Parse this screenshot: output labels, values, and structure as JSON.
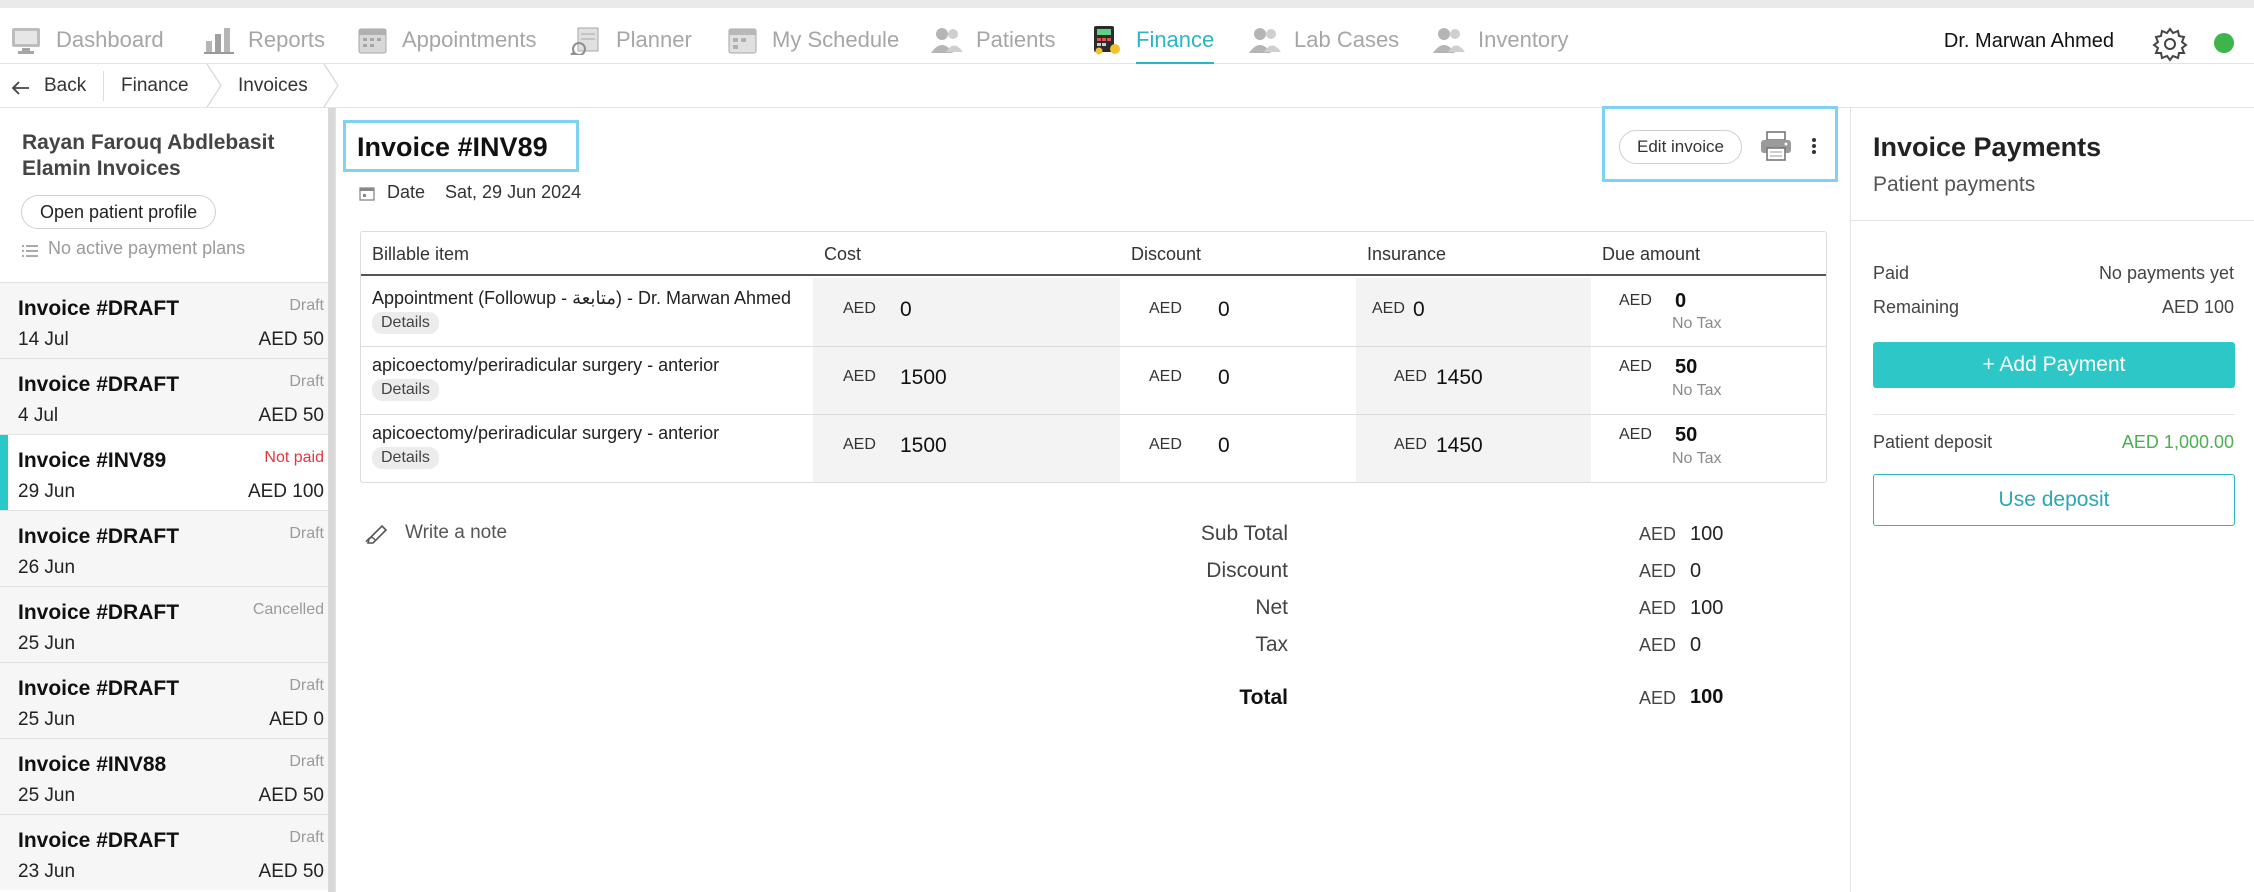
{
  "nav": {
    "items": [
      {
        "label": "Dashboard",
        "icon": "dashboard-icon"
      },
      {
        "label": "Reports",
        "icon": "reports-icon"
      },
      {
        "label": "Appointments",
        "icon": "appointments-icon"
      },
      {
        "label": "Planner",
        "icon": "planner-icon"
      },
      {
        "label": "My Schedule",
        "icon": "schedule-icon"
      },
      {
        "label": "Patients",
        "icon": "patients-icon"
      },
      {
        "label": "Finance",
        "icon": "finance-icon"
      },
      {
        "label": "Lab Cases",
        "icon": "lab-cases-icon"
      },
      {
        "label": "Inventory",
        "icon": "inventory-icon"
      }
    ],
    "active": "Finance",
    "user_name": "Dr. Marwan Ahmed",
    "accent_color": "#2ab7c4",
    "status_color": "#3cb54a"
  },
  "breadcrumb": {
    "back_label": "Back",
    "items": [
      "Finance",
      "Invoices"
    ]
  },
  "sidebar": {
    "patient_title": "Rayan Farouq Abdlebasit Elamin Invoices",
    "open_profile_label": "Open patient profile",
    "payment_plans_text": "No active payment plans",
    "invoices": [
      {
        "name": "Invoice #DRAFT",
        "date": "14 Jul",
        "status": "Draft",
        "amount": "AED 50"
      },
      {
        "name": "Invoice #DRAFT",
        "date": "4 Jul",
        "status": "Draft",
        "amount": "AED 50"
      },
      {
        "name": "Invoice #INV89",
        "date": "29 Jun",
        "status": "Not paid",
        "amount": "AED 100"
      },
      {
        "name": "Invoice #DRAFT",
        "date": "26 Jun",
        "status": "Draft",
        "amount": ""
      },
      {
        "name": "Invoice #DRAFT",
        "date": "25 Jun",
        "status": "Cancelled",
        "amount": ""
      },
      {
        "name": "Invoice #DRAFT",
        "date": "25 Jun",
        "status": "Draft",
        "amount": "AED 0"
      },
      {
        "name": "Invoice #INV88",
        "date": "25 Jun",
        "status": "Draft",
        "amount": "AED 50"
      },
      {
        "name": "Invoice #DRAFT",
        "date": "23 Jun",
        "status": "Draft",
        "amount": "AED 50"
      }
    ]
  },
  "invoice": {
    "title": "Invoice #INV89",
    "date_label": "Date",
    "date_value": "Sat, 29 Jun 2024",
    "edit_label": "Edit invoice",
    "columns": [
      "Billable item",
      "Cost",
      "Discount",
      "Insurance",
      "Due amount"
    ],
    "rows": [
      {
        "item": "Appointment (Followup - متابعة) - Dr. Marwan Ahmed",
        "details_label": "Details",
        "cost_currency": "AED",
        "cost": "0",
        "discount_currency": "AED",
        "discount": "0",
        "insurance_currency": "AED",
        "insurance": "0",
        "due_currency": "AED",
        "due": "0",
        "tax_note": "No Tax"
      },
      {
        "item": "apicoectomy/periradicular surgery - anterior",
        "details_label": "Details",
        "cost_currency": "AED",
        "cost": "1500",
        "discount_currency": "AED",
        "discount": "0",
        "insurance_currency": "AED",
        "insurance": "1450",
        "due_currency": "AED",
        "due": "50",
        "tax_note": "No Tax"
      },
      {
        "item": "apicoectomy/periradicular surgery - anterior",
        "details_label": "Details",
        "cost_currency": "AED",
        "cost": "1500",
        "discount_currency": "AED",
        "discount": "0",
        "insurance_currency": "AED",
        "insurance": "1450",
        "due_currency": "AED",
        "due": "50",
        "tax_note": "No Tax"
      }
    ],
    "note_label": "Write a note",
    "totals": [
      {
        "label": "Sub Total",
        "currency": "AED",
        "value": "100"
      },
      {
        "label": "Discount",
        "currency": "AED",
        "value": "0"
      },
      {
        "label": "Net",
        "currency": "AED",
        "value": "100"
      },
      {
        "label": "Tax",
        "currency": "AED",
        "value": "0"
      },
      {
        "label": "Total",
        "currency": "AED",
        "value": "100"
      }
    ]
  },
  "payments": {
    "title": "Invoice Payments",
    "subtitle": "Patient payments",
    "paid_label": "Paid",
    "paid_value": "No payments yet",
    "remaining_label": "Remaining",
    "remaining_value": "AED 100",
    "add_payment_label": "+ Add Payment",
    "deposit_label": "Patient deposit",
    "deposit_value": "AED 1,000.00",
    "use_deposit_label": "Use deposit",
    "deposit_color": "#4caf50"
  }
}
